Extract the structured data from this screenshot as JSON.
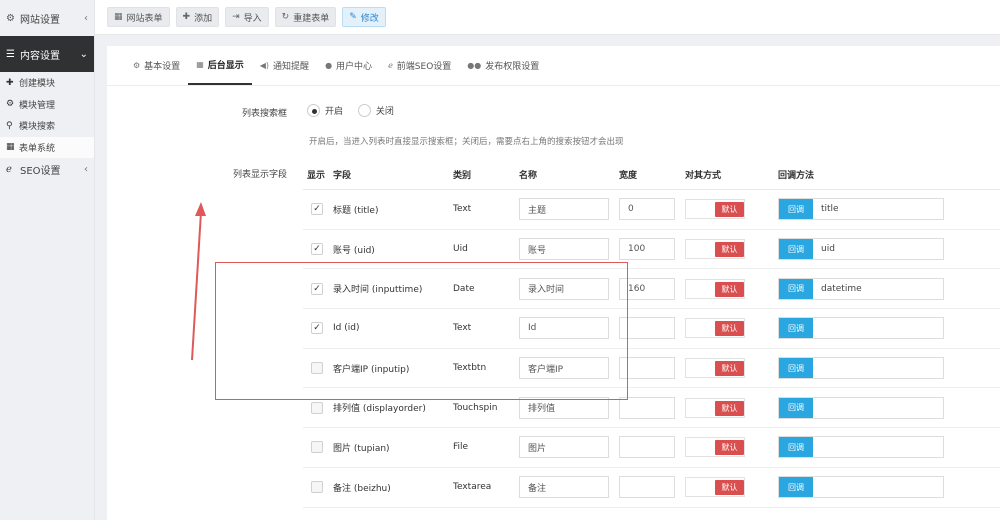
{
  "sidebar": {
    "top_menus": [
      {
        "label": "网站设置",
        "icon": "gear-icon"
      },
      {
        "label": "内容设置",
        "icon": "menu-icon"
      }
    ],
    "sub_items": [
      {
        "label": "创建模块",
        "icon": "plus-icon"
      },
      {
        "label": "模块管理",
        "icon": "gears-icon"
      },
      {
        "label": "模块搜索",
        "icon": "search-icon"
      },
      {
        "label": "表单系统",
        "icon": "table-icon"
      }
    ],
    "seo": {
      "label": "SEO设置",
      "icon": "ie-icon"
    }
  },
  "toolbar": {
    "form_list": "网站表单",
    "add": "添加",
    "import": "导入",
    "rebuild": "重建表单",
    "edit": "修改"
  },
  "tabs": [
    {
      "label": "基本设置",
      "icon": "gear-icon"
    },
    {
      "label": "后台显示",
      "icon": "table-icon"
    },
    {
      "label": "通知提醒",
      "icon": "volume-icon"
    },
    {
      "label": "用户中心",
      "icon": "user-icon"
    },
    {
      "label": "前端SEO设置",
      "icon": "ie-icon"
    },
    {
      "label": "发布权限设置",
      "icon": "users-icon"
    }
  ],
  "search_box": {
    "label": "列表搜索框",
    "on": "开启",
    "off": "关闭",
    "selected": "开启",
    "hint": "开启后，当进入列表时直接显示搜索框；关闭后，需要点右上角的搜索按钮才会出现"
  },
  "fields_label": "列表显示字段",
  "table": {
    "headers": {
      "show": "显示",
      "field": "字段",
      "type": "类别",
      "name": "名称",
      "width": "宽度",
      "align": "对其方式",
      "callback": "回调方法"
    },
    "default_label": "默认",
    "callback_btn": "回调",
    "rows": [
      {
        "checked": true,
        "field": "标题 (title)",
        "type": "Text",
        "name": "主题",
        "width": "0",
        "callback": "title"
      },
      {
        "checked": true,
        "field": "账号 (uid)",
        "type": "Uid",
        "name": "账号",
        "width": "100",
        "callback": "uid"
      },
      {
        "checked": true,
        "field": "录入时间 (inputtime)",
        "type": "Date",
        "name": "录入时间",
        "width": "160",
        "callback": "datetime"
      },
      {
        "checked": true,
        "field": "Id (id)",
        "type": "Text",
        "name": "Id",
        "width": "",
        "callback": ""
      },
      {
        "checked": false,
        "field": "客户端IP (inputip)",
        "type": "Textbtn",
        "name": "客户端IP",
        "width": "",
        "callback": ""
      },
      {
        "checked": false,
        "field": "排列值 (displayorder)",
        "type": "Touchspin",
        "name": "排列值",
        "width": "",
        "callback": ""
      },
      {
        "checked": false,
        "field": "图片 (tupian)",
        "type": "File",
        "name": "图片",
        "width": "",
        "callback": ""
      },
      {
        "checked": false,
        "field": "备注 (beizhu)",
        "type": "Textarea",
        "name": "备注",
        "width": "",
        "callback": ""
      }
    ]
  },
  "colors": {
    "accent_blue": "#2aa7e0",
    "default_red": "#d94e4e",
    "annotation_red": "#e0595a",
    "sidebar_active": "#2f3133"
  }
}
